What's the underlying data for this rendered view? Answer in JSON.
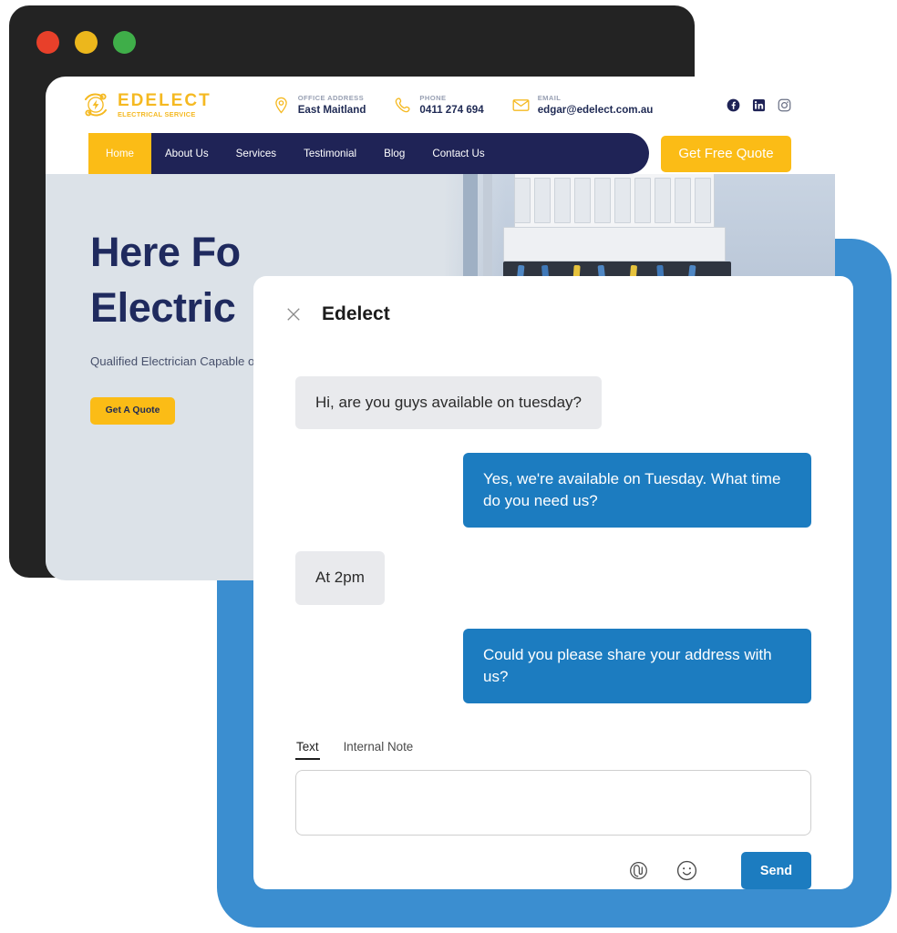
{
  "browser_window": {
    "traffic_lights": [
      {
        "name": "close",
        "color": "#e8402a"
      },
      {
        "name": "minimize",
        "color": "#ecb71c"
      },
      {
        "name": "maximize",
        "color": "#3fae49"
      }
    ]
  },
  "backdrop": {
    "color": "#3b8ed0"
  },
  "site": {
    "logo": {
      "name": "EDELECT",
      "tagline": "ELECTRICAL SERVICE",
      "color": "#f5b921"
    },
    "contacts": [
      {
        "icon": "location-pin-icon",
        "label": "OFFICE ADDRESS",
        "value": "East Maitland"
      },
      {
        "icon": "phone-icon",
        "label": "PHONE",
        "value": "0411 274 694"
      },
      {
        "icon": "envelope-icon",
        "label": "EMAIL",
        "value": "edgar@edelect.com.au"
      }
    ],
    "socials": [
      {
        "icon": "facebook-icon",
        "label": "Facebook"
      },
      {
        "icon": "linkedin-icon",
        "label": "LinkedIn"
      },
      {
        "icon": "instagram-icon",
        "label": "Instagram"
      }
    ],
    "nav": {
      "items": [
        {
          "label": "Home",
          "active": true
        },
        {
          "label": "About Us",
          "active": false
        },
        {
          "label": "Services",
          "active": false
        },
        {
          "label": "Testimonial",
          "active": false
        },
        {
          "label": "Blog",
          "active": false
        },
        {
          "label": "Contact Us",
          "active": false
        }
      ],
      "active_color": "#fbbc16",
      "bar_color": "#1f2356"
    },
    "quote_button": "Get Free Quote",
    "hero": {
      "title_line1": "Here Fo",
      "title_line2": "Electric",
      "subtitle": "Qualified Electrician Capable of",
      "button": "Get A Quote",
      "background": "#dce2e8",
      "photo_alt": "electrical-switchboard-photo"
    }
  },
  "chat": {
    "title": "Edelect",
    "close_icon": "close-icon",
    "messages": [
      {
        "from": "customer",
        "text": "Hi, are you guys available on tuesday?"
      },
      {
        "from": "agent",
        "text": "Yes, we're available on Tuesday. What time do you need us?"
      },
      {
        "from": "customer",
        "text": "At 2pm"
      },
      {
        "from": "agent",
        "text": "Could you please share your address with us?"
      }
    ],
    "tabs": [
      {
        "label": "Text",
        "active": true
      },
      {
        "label": "Internal Note",
        "active": false
      }
    ],
    "input": {
      "value": "",
      "placeholder": ""
    },
    "actions": [
      {
        "icon": "attachment-icon",
        "label": "Attach file"
      },
      {
        "icon": "emoji-icon",
        "label": "Insert emoji"
      }
    ],
    "send_button": "Send",
    "accent_color": "#1c7cc0",
    "incoming_bubble_color": "#e9eaed"
  }
}
